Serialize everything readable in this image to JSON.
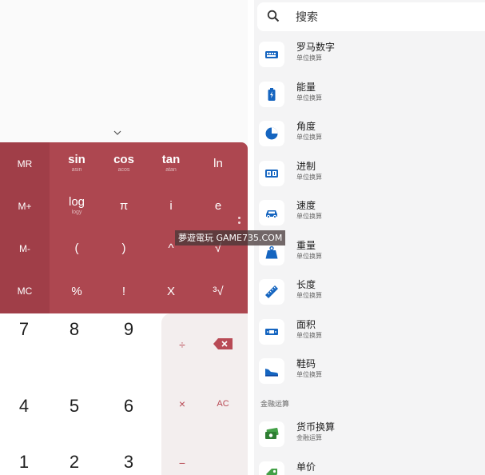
{
  "calculator": {
    "memory_keys": [
      "MR",
      "M+",
      "M-",
      "MC"
    ],
    "sci_rows": [
      [
        {
          "main": "sin",
          "sub": "asin"
        },
        {
          "main": "cos",
          "sub": "acos"
        },
        {
          "main": "tan",
          "sub": "atan"
        },
        {
          "main": "ln"
        }
      ],
      [
        {
          "main": "log",
          "sub": "logy"
        },
        {
          "main": "π"
        },
        {
          "main": "i"
        },
        {
          "main": "e"
        }
      ],
      [
        {
          "main": "("
        },
        {
          "main": ")"
        },
        {
          "main": "^"
        },
        {
          "main": "√"
        }
      ],
      [
        {
          "main": "%"
        },
        {
          "main": "!"
        },
        {
          "main": "X"
        },
        {
          "main": "³√"
        }
      ]
    ],
    "numpad_rows": [
      [
        "7",
        "8",
        "9"
      ],
      [
        "4",
        "5",
        "6"
      ],
      [
        "1",
        "2",
        "3"
      ]
    ],
    "ops": {
      "divide": "÷",
      "multiply": "×",
      "clear": "AC",
      "subtract": "−"
    },
    "colors": {
      "accent": "#ad4750",
      "memory_column": "#a03e48",
      "operator_text": "#b84a55",
      "backspace": "#b84a55"
    }
  },
  "search": {
    "placeholder": "搜索"
  },
  "converters": [
    {
      "icon": "roman-numeral-icon",
      "title": "罗马数字",
      "subtitle": "单位换算"
    },
    {
      "icon": "energy-battery-icon",
      "title": "能量",
      "subtitle": "单位换算"
    },
    {
      "icon": "angle-pie-icon",
      "title": "角度",
      "subtitle": "单位换算"
    },
    {
      "icon": "number-base-icon",
      "title": "进制",
      "subtitle": "单位换算"
    },
    {
      "icon": "car-speed-icon",
      "title": "速度",
      "subtitle": "单位换算"
    },
    {
      "icon": "weight-icon",
      "title": "重量",
      "subtitle": "单位换算"
    },
    {
      "icon": "ruler-icon",
      "title": "长度",
      "subtitle": "单位换算"
    },
    {
      "icon": "area-icon",
      "title": "面积",
      "subtitle": "单位换算"
    },
    {
      "icon": "shoe-icon",
      "title": "鞋码",
      "subtitle": "单位换算"
    }
  ],
  "finance_section": {
    "header": "金融运算",
    "items": [
      {
        "icon": "currency-icon",
        "title": "货币换算",
        "subtitle": "金融运算"
      },
      {
        "icon": "unit-price-icon",
        "title": "单价",
        "subtitle": ""
      }
    ]
  },
  "watermark": "夢遊電玩 GAME735.COM"
}
